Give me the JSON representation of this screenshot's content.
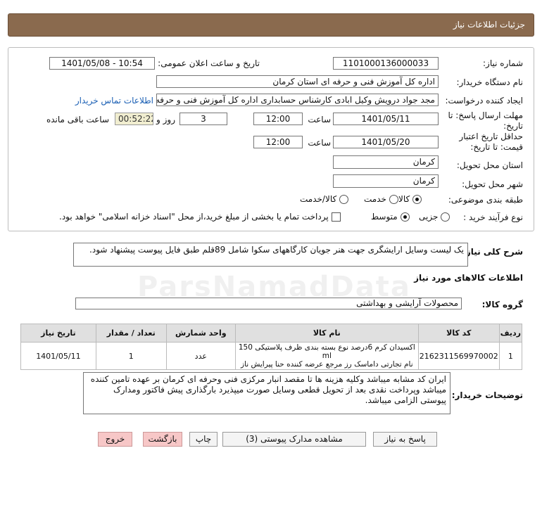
{
  "header": {
    "title": "جزئیات اطلاعات نیاز"
  },
  "form": {
    "need_number_label": "شماره نیاز:",
    "need_number": "1101000136000033",
    "announce_label": "تاریخ و ساعت اعلان عمومی:",
    "announce_value": "1401/05/08 - 10:54",
    "buyer_label": "نام دستگاه خریدار:",
    "buyer_value": "اداره کل آموزش فنی و حرفه ای استان کرمان",
    "requester_label": "ایجاد کننده درخواست:",
    "requester_value": "مجد جواد درویش وکیل ابادی کارشناس حسابداری اداره کل آموزش فنی و حرفه",
    "contact_link": "اطلاعات تماس خریدار",
    "deadline_label_1": "مهلت ارسال پاسخ: تا",
    "deadline_label_2": "تاریخ:",
    "deadline_date": "1401/05/11",
    "time_label": "ساعت",
    "deadline_time": "12:00",
    "days_value": "3",
    "days_label": "روز و",
    "remaining_time": "00:52:22",
    "remaining_label": "ساعت باقی مانده",
    "validity_label_1": "حداقل تاریخ اعتبار",
    "validity_label_2": "قیمت: تا تاریخ:",
    "validity_date": "1401/05/20",
    "validity_time_label": "ساعت",
    "validity_time": "12:00",
    "province_label": "استان محل تحویل:",
    "province_value": "کرمان",
    "city_label": "شهر محل تحویل:",
    "city_value": "کرمان",
    "category_label": "طبقه بندی موضوعی:",
    "category_options": [
      "کالا",
      "خدمت",
      "کالا/خدمت"
    ],
    "process_label": "نوع فرآیند خرید :",
    "process_options": [
      "جزیی",
      "متوسط"
    ],
    "payment_note": "پرداخت تمام یا بخشی از مبلغ خرید،از محل \"اسناد خزانه اسلامی\" خواهد بود."
  },
  "summary": {
    "label": "شرح کلی نیاز:",
    "text": "یک لیست وسایل ارایشگری جهت هنر جویان کارگاههای سکوا شامل 89قلم طبق فایل پیوست پیشنهاد شود."
  },
  "goods": {
    "section_title": "اطلاعات کالاهای مورد نیاز",
    "group_label": "گروه کالا:",
    "group_value": "محصولات آرایشی و بهداشتی",
    "columns": [
      "ردیف",
      "کد کالا",
      "نام کالا",
      "واحد شمارش",
      "تعداد / مقدار",
      "تاریخ نیاز"
    ],
    "rows": [
      {
        "index": "1",
        "code": "2162311569970002",
        "name_line1": "اکسیدان کرم 6درصد نوع بسته بندی ظرف پلاستیکی 150 ml",
        "name_line2": "نام تجارتی داماسک رز مرجع عرضه کننده حنا پیرایش ناز",
        "unit": "عدد",
        "qty": "1",
        "date": "1401/05/11"
      }
    ]
  },
  "notes": {
    "label": "توضیحات خریدار:",
    "text": "ایران کد مشابه میباشد وکلیه هزینه ها تا مقصد انبار مرکزی فنی وحرفه ای کرمان بر عهده تامین کننده میباشد وپرداخت نقدی بعد از تحویل قطعی وسایل  صورت میپذیرد بارگذاری پیش فاکتور ومدارک پیوستی الزامی میباشد."
  },
  "buttons": {
    "reply": "پاسخ به نیاز",
    "attachments": "مشاهده مدارک پیوستی (3)",
    "print": "چاپ",
    "back": "بازگشت",
    "exit": "خروج"
  },
  "watermark": "ParsNamadData",
  "colors": {
    "header_bg": "#8a6a4e",
    "timer_bg": "#f1eed0",
    "exit_bg": "#f7c7c7"
  }
}
